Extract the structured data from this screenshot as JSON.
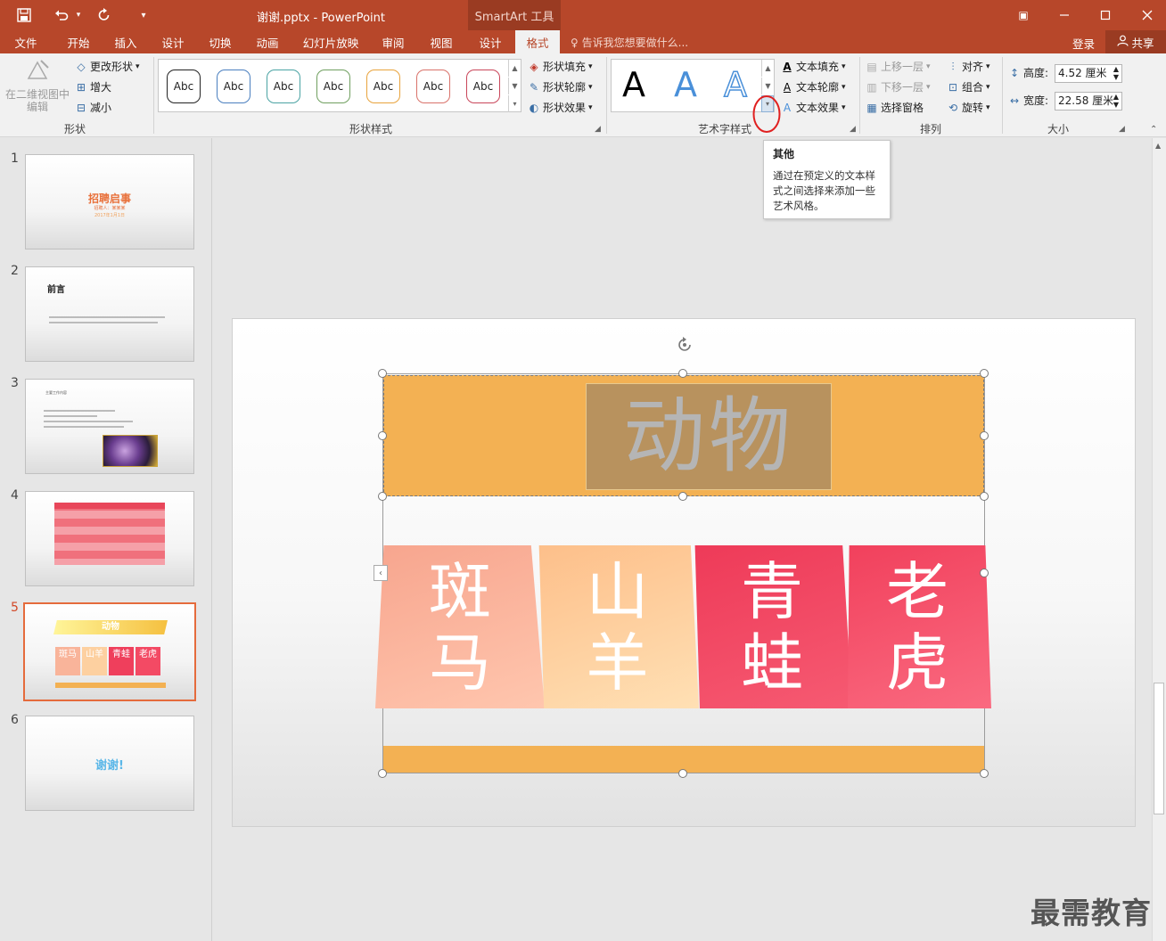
{
  "window": {
    "title": "谢谢.pptx - PowerPoint",
    "context_tab_group": "SmartArt 工具",
    "buttons": {
      "restore_ribbon": "▣",
      "minimize": "—",
      "maximize": "☐",
      "close": "✕"
    }
  },
  "quick_access": {
    "save": "save-icon",
    "undo": "undo-icon",
    "redo": "redo-icon",
    "customize": "customize-icon"
  },
  "tabs": [
    {
      "label": "文件"
    },
    {
      "label": "开始"
    },
    {
      "label": "插入"
    },
    {
      "label": "设计"
    },
    {
      "label": "切换"
    },
    {
      "label": "动画"
    },
    {
      "label": "幻灯片放映"
    },
    {
      "label": "审阅"
    },
    {
      "label": "视图"
    },
    {
      "label": "设计"
    },
    {
      "label": "格式"
    }
  ],
  "tell_me": "告诉我您想要做什么...",
  "signin": "登录",
  "share": "共享",
  "ribbon": {
    "shapes": {
      "edit_2d": "在二维视图中编辑",
      "change_shape": "更改形状",
      "larger": "增大",
      "smaller": "减小",
      "label": "形状"
    },
    "shape_styles": {
      "sample_text": "Abc",
      "swatch_colors": [
        "#222222",
        "#4a7fbf",
        "#4aa3a3",
        "#6f9f5f",
        "#e8a33c",
        "#d9726a",
        "#c9465a"
      ],
      "fill": "形状填充",
      "outline": "形状轮廓",
      "effects": "形状效果",
      "label": "形状样式"
    },
    "wordart": {
      "samples": [
        "A",
        "A",
        "A"
      ],
      "text_fill": "文本填充",
      "text_outline": "文本轮廓",
      "text_effects": "文本效果",
      "label": "艺术字样式"
    },
    "arrange": {
      "bring_forward": "上移一层",
      "send_backward": "下移一层",
      "selection_pane": "选择窗格",
      "align": "对齐",
      "group": "组合",
      "rotate": "旋转",
      "label": "排列"
    },
    "size": {
      "height_label": "高度:",
      "height_value": "4.52 厘米",
      "width_label": "宽度:",
      "width_value": "22.58 厘米",
      "label": "大小"
    }
  },
  "tooltip": {
    "title": "其他",
    "description": "通过在预定义的文本样式之间选择来添加一些艺术风格。"
  },
  "slides": [
    {
      "number": "1",
      "title": "招聘启事",
      "line1": "招聘人：某某某",
      "line2": "2017年1月1日"
    },
    {
      "number": "2",
      "title": "前言"
    },
    {
      "number": "3",
      "title": "主要工作内容"
    },
    {
      "number": "4"
    },
    {
      "number": "5",
      "title": "动物",
      "cells": [
        "斑马",
        "山羊",
        "青蛙",
        "老虎"
      ]
    },
    {
      "number": "6",
      "title": "谢谢!"
    }
  ],
  "active_slide": 5,
  "smartart": {
    "title": "动物",
    "items": [
      {
        "line1": "斑",
        "line2": "马",
        "color": "#f9a98f"
      },
      {
        "line1": "山",
        "line2": "羊",
        "color": "#fdc58f"
      },
      {
        "line1": "青",
        "line2": "蛙",
        "color": "#ef3f5c"
      },
      {
        "line1": "老",
        "line2": "虎",
        "color": "#f34a64"
      }
    ],
    "band_color": "#f3b153",
    "title_box_color": "#b8925e"
  },
  "watermark": "最需教育"
}
